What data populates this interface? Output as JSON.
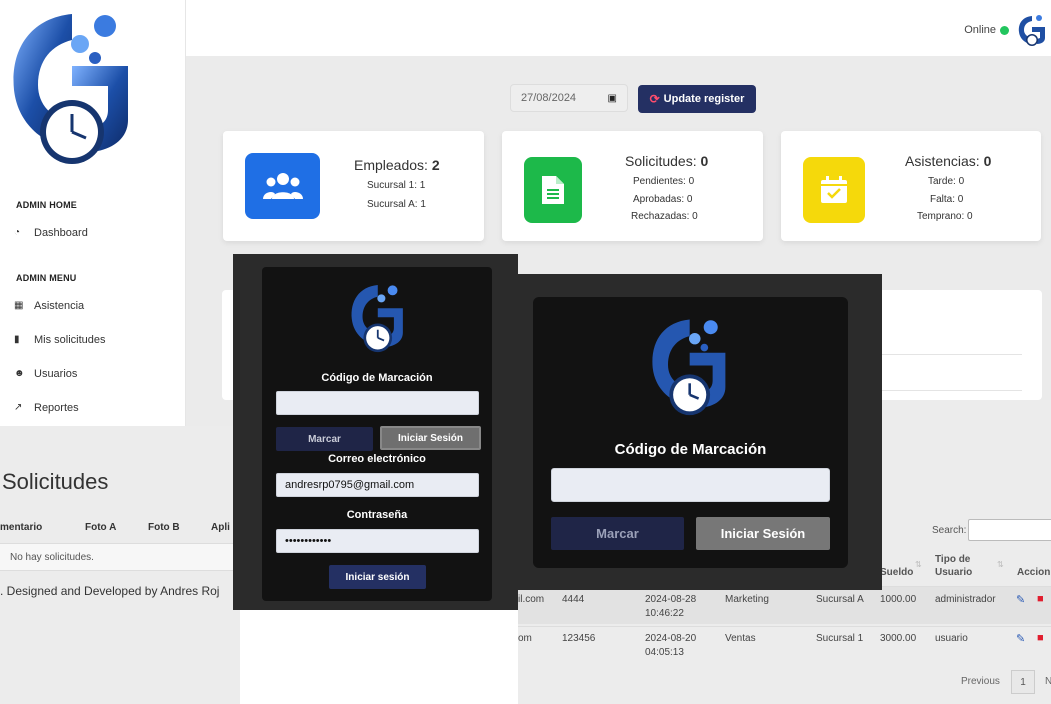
{
  "sidebar": {
    "sections": [
      {
        "title": "ADMIN HOME",
        "items": [
          {
            "label": "Dashboard",
            "icon": "gauge-icon"
          }
        ]
      },
      {
        "title": "ADMIN MENU",
        "items": [
          {
            "label": "Asistencia",
            "icon": "calendar-check-icon"
          },
          {
            "label": "Mis solicitudes",
            "icon": "file-icon"
          },
          {
            "label": "Usuarios",
            "icon": "users-icon"
          },
          {
            "label": "Reportes",
            "icon": "chart-line-icon"
          }
        ]
      }
    ]
  },
  "topbar": {
    "status": "Online"
  },
  "toolbar": {
    "date": "27/08/2024",
    "update_label": "Update register"
  },
  "cards": [
    {
      "title": "Empleados:",
      "value": "2",
      "lines": [
        "Sucursal 1: 1",
        "Sucursal A: 1"
      ],
      "color": "#1f6fe5",
      "icon": "users-icon"
    },
    {
      "title": "Solicitudes:",
      "value": "0",
      "lines": [
        "Pendientes: 0",
        "Aprobadas: 0",
        "Rechazadas: 0"
      ],
      "color": "#1db94a",
      "icon": "document-icon"
    },
    {
      "title": "Asistencias:",
      "value": "0",
      "lines": [
        "Tarde: 0",
        "Falta: 0",
        "Temprano: 0"
      ],
      "color": "#f5d90b",
      "icon": "calendar-check-icon"
    }
  ],
  "solicitudes": {
    "title": "Solicitudes",
    "columns": [
      "mentario",
      "Foto A",
      "Foto B",
      "Apli"
    ],
    "empty": "No hay solicitudes.",
    "footer": ". Designed and Developed by Andres Roj"
  },
  "users_table": {
    "search_label": "Search:",
    "columns": [
      "Sueldo",
      "Tipo de\nUsuario",
      "Accion"
    ],
    "rows": [
      {
        "email": "il.com",
        "code": "4444",
        "date": "2024-08-28",
        "time": "10:46:22",
        "area": "Marketing",
        "branch": "Sucursal A",
        "salary": "1000.00",
        "type": "administrador"
      },
      {
        "email": "om",
        "code": "123456",
        "date": "2024-08-20",
        "time": "04:05:13",
        "area": "Ventas",
        "branch": "Sucursal 1",
        "salary": "3000.00",
        "type": "usuario"
      }
    ],
    "pager": {
      "prev": "Previous",
      "page": "1",
      "next": "N"
    }
  },
  "modal_small": {
    "code_label": "Código de Marcación",
    "mark_label": "Marcar",
    "login_label": "Iniciar Sesión",
    "email_label": "Correo electrónico",
    "email_value": "andresrp0795@gmail.com",
    "password_label": "Contraseña",
    "password_value": "••••••••••••",
    "submit_label": "Iniciar sesión"
  },
  "modal_big": {
    "code_label": "Código de Marcación",
    "mark_label": "Marcar",
    "login_label": "Iniciar Sesión"
  }
}
